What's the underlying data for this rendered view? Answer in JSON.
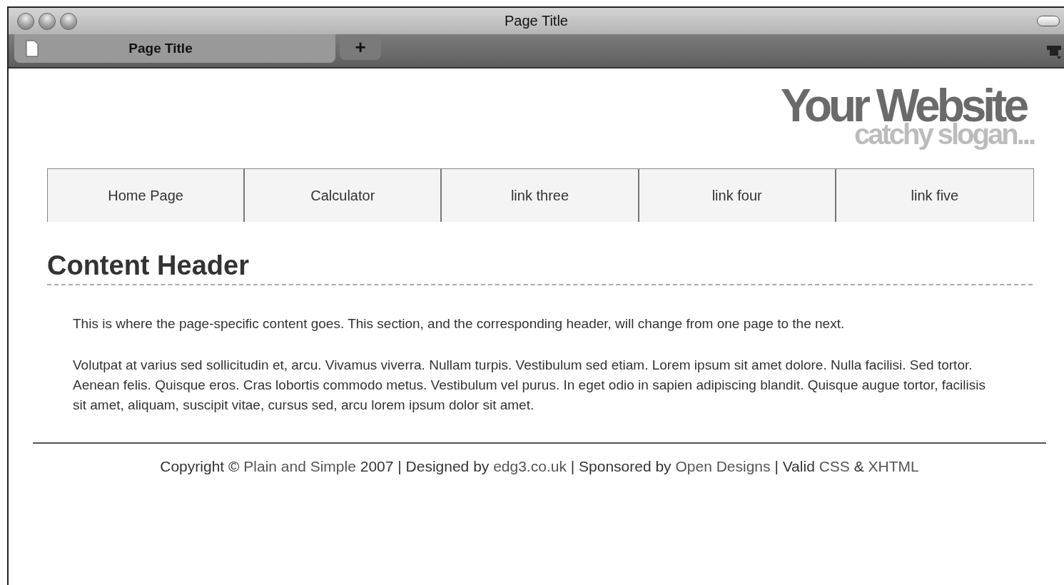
{
  "window": {
    "title": "Page Title"
  },
  "tabs": [
    {
      "label": "Page Title",
      "selected": true
    }
  ],
  "new_tab": {
    "label": "+"
  },
  "site": {
    "name": "Your Website",
    "slogan": "catchy slogan..."
  },
  "nav": [
    {
      "label": "Home Page"
    },
    {
      "label": "Calculator"
    },
    {
      "label": "link three"
    },
    {
      "label": "link four"
    },
    {
      "label": "link five"
    }
  ],
  "content": {
    "header": "Content Header",
    "paragraphs": [
      "This is where the page-specific content goes. This section, and the corresponding header, will change from one page to the next.",
      "Volutpat at varius sed sollicitudin et, arcu. Vivamus viverra. Nullam turpis. Vestibulum sed etiam. Lorem ipsum sit amet dolore. Nulla facilisi. Sed tortor. Aenean felis. Quisque eros. Cras lobortis commodo metus. Vestibulum vel purus. In eget odio in sapien adipiscing blandit. Quisque augue tortor, facilisis sit amet, aliquam, suscipit vitae, cursus sed, arcu lorem ipsum dolor sit amet."
    ]
  },
  "footer": [
    {
      "kind": "text",
      "text": "Copyright © "
    },
    {
      "kind": "link",
      "text": "Plain and Simple"
    },
    {
      "kind": "text",
      "text": " 2007 | Designed by "
    },
    {
      "kind": "link",
      "text": "edg3.co.uk"
    },
    {
      "kind": "text",
      "text": " | Sponsored by "
    },
    {
      "kind": "link",
      "text": "Open Designs"
    },
    {
      "kind": "text",
      "text": " | Valid "
    },
    {
      "kind": "link",
      "text": "CSS"
    },
    {
      "kind": "text",
      "text": " & "
    },
    {
      "kind": "link",
      "text": "XHTML"
    }
  ]
}
